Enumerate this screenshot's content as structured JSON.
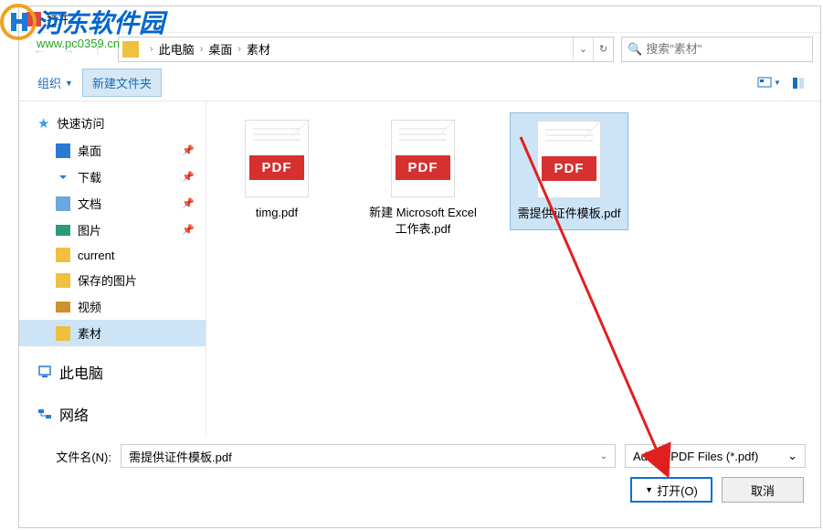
{
  "watermark": {
    "brand": "河东软件园",
    "url": "www.pc0359.cn"
  },
  "dialog_title": "打开",
  "breadcrumb": {
    "items": [
      "此电脑",
      "桌面",
      "素材"
    ]
  },
  "search": {
    "placeholder": "搜索\"素材\""
  },
  "toolbar": {
    "organize": "组织",
    "new_folder": "新建文件夹"
  },
  "sidebar": {
    "quick_access": "快速访问",
    "items": [
      {
        "label": "桌面",
        "icon": "desktop",
        "pinned": true
      },
      {
        "label": "下载",
        "icon": "download",
        "pinned": true
      },
      {
        "label": "文档",
        "icon": "doc",
        "pinned": true
      },
      {
        "label": "图片",
        "icon": "pic",
        "pinned": true
      },
      {
        "label": "current",
        "icon": "folder",
        "pinned": false
      },
      {
        "label": "保存的图片",
        "icon": "folder",
        "pinned": false
      },
      {
        "label": "视频",
        "icon": "video",
        "pinned": false
      },
      {
        "label": "素材",
        "icon": "folder",
        "pinned": false,
        "selected": true
      }
    ],
    "this_pc": "此电脑",
    "network": "网络"
  },
  "files": [
    {
      "name": "timg.pdf",
      "type": "PDF"
    },
    {
      "name": "新建 Microsoft Excel 工作表.pdf",
      "type": "PDF"
    },
    {
      "name": "需提供证件模板.pdf",
      "type": "PDF",
      "selected": true
    }
  ],
  "footer": {
    "filename_label": "文件名(N):",
    "filename_value": "需提供证件模板.pdf",
    "filter": "Adobe PDF Files (*.pdf)",
    "open_button": "打开(O)",
    "cancel_button": "取消"
  }
}
